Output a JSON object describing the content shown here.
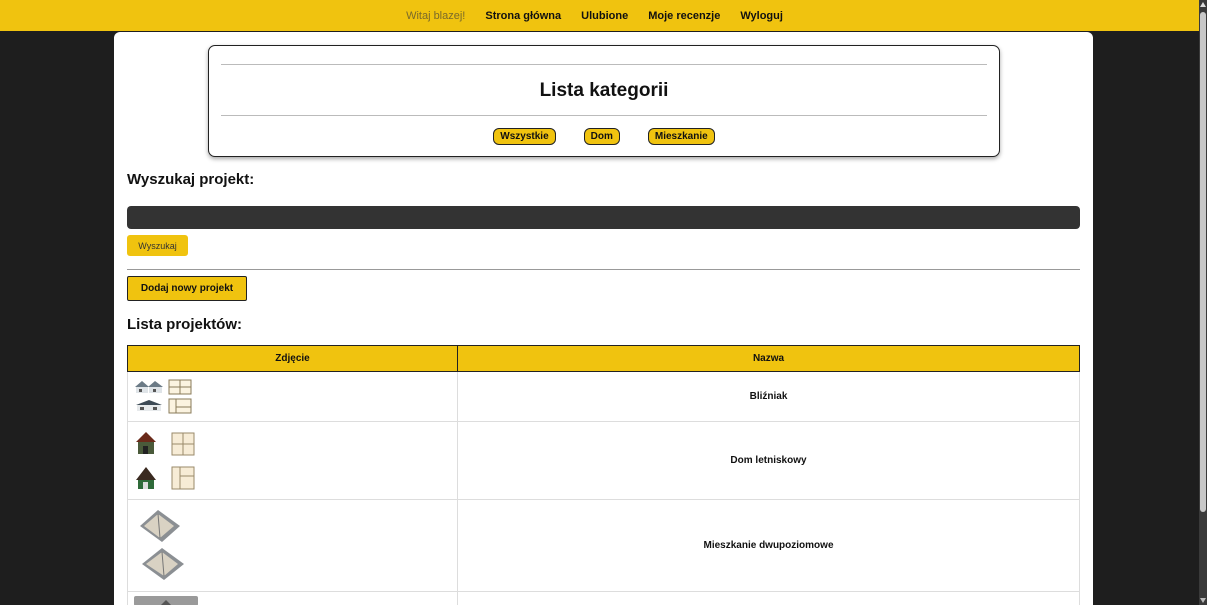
{
  "nav": {
    "greeting": "Witaj blazej!",
    "links": [
      "Strona główna",
      "Ulubione",
      "Moje recenzje",
      "Wyloguj"
    ]
  },
  "categories": {
    "title": "Lista kategorii",
    "buttons": [
      "Wszystkie",
      "Dom",
      "Mieszkanie"
    ]
  },
  "search": {
    "heading": "Wyszukaj projekt:",
    "placeholder": "",
    "value": "",
    "button_label": "Wyszukaj"
  },
  "add_button_label": "Dodaj nowy projekt",
  "projects": {
    "heading": "Lista projektów:",
    "columns": [
      "Zdjęcie",
      "Nazwa"
    ],
    "rows": [
      {
        "name": "Bliźniak",
        "image_icon": "house-plan-thumbnail"
      },
      {
        "name": "Dom letniskowy",
        "image_icon": "cottage-plan-thumbnail"
      },
      {
        "name": "Mieszkanie dwupoziomowe",
        "image_icon": "apartment-3d-thumbnail"
      },
      {
        "name": "",
        "image_icon": "plan-thumbnail"
      }
    ]
  },
  "colors": {
    "accent": "#f0c30f",
    "background": "#1e1e1e",
    "panel": "#ffffff",
    "input": "#333333"
  }
}
